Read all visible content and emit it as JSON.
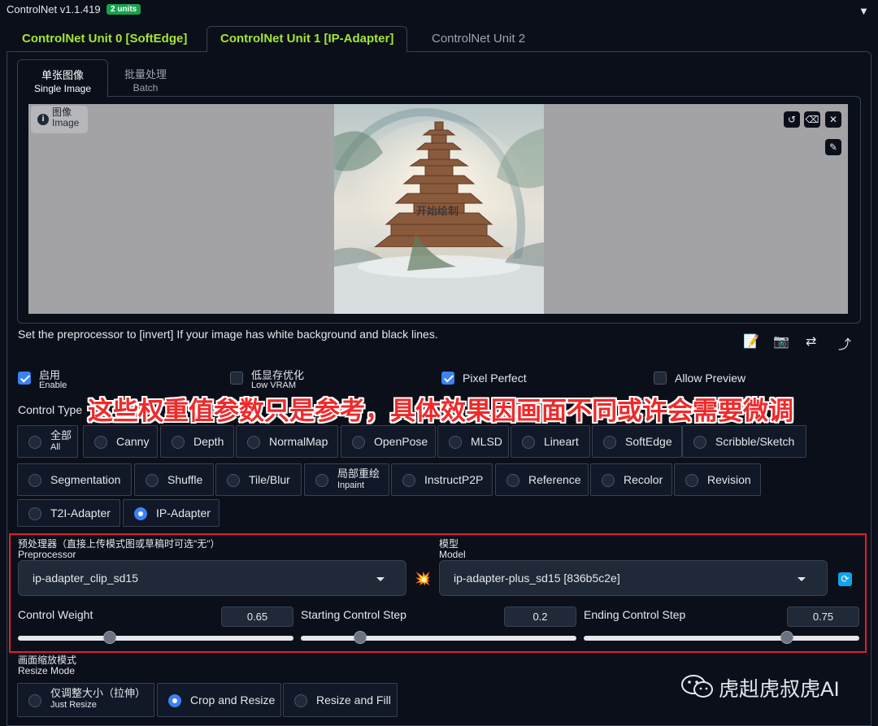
{
  "header": {
    "title": "ControlNet v1.1.419",
    "badge": "2 units",
    "collapse_icon": "triangle-down-icon"
  },
  "unit_tabs": [
    {
      "label": "ControlNet Unit 0 [SoftEdge]"
    },
    {
      "label": "ControlNet Unit 1 [IP-Adapter]"
    },
    {
      "label": "ControlNet Unit 2"
    }
  ],
  "image_tabs": [
    {
      "label": "单张图像",
      "sub": "Single Image"
    },
    {
      "label": "批量处理",
      "sub": "Batch"
    }
  ],
  "image_input": {
    "label": "图像",
    "sub": "Image",
    "draw_text": "开始绘制"
  },
  "hint": "Set the preprocessor to [invert] If your image has white background and black lines.",
  "checks": {
    "enable": {
      "label": "启用",
      "sub": "Enable",
      "checked": true
    },
    "low_vram": {
      "label": "低显存优化",
      "sub": "Low VRAM",
      "checked": false
    },
    "pixel_perfect": {
      "label": "Pixel Perfect",
      "checked": true
    },
    "allow_preview": {
      "label": "Allow Preview",
      "checked": false
    }
  },
  "control_type": {
    "label": "Control Type",
    "selected": "IP-Adapter",
    "all": {
      "label": "全部",
      "sub": "All"
    },
    "inpaint": {
      "label": "局部重绘",
      "sub": "Inpaint"
    },
    "options": [
      "Canny",
      "Depth",
      "NormalMap",
      "OpenPose",
      "MLSD",
      "Lineart",
      "SoftEdge",
      "Scribble/Sketch",
      "Segmentation",
      "Shuffle",
      "Tile/Blur",
      "InstructP2P",
      "Reference",
      "Recolor",
      "Revision",
      "T2I-Adapter",
      "IP-Adapter"
    ]
  },
  "overlay_annotation": "这些权重值参数只是参考，具体效果因画面不同或许会需要微调",
  "preprocessor": {
    "label": "预处理器（直接上传模式图或草稿时可选\"无\"）",
    "sub": "Preprocessor",
    "value": "ip-adapter_clip_sd15"
  },
  "model": {
    "label": "模型",
    "sub": "Model",
    "value": "ip-adapter-plus_sd15 [836b5c2e]"
  },
  "sliders": {
    "control_weight": {
      "label": "Control Weight",
      "value": "0.65",
      "fraction": 0.325
    },
    "starting_step": {
      "label": "Starting Control Step",
      "value": "0.2",
      "fraction": 0.2
    },
    "ending_step": {
      "label": "Ending Control Step",
      "value": "0.75",
      "fraction": 0.75
    }
  },
  "resize_mode": {
    "label": "画面缩放模式",
    "sub": "Resize Mode",
    "just_resize": {
      "label": "仅调整大小（拉伸）",
      "sub": "Just Resize"
    },
    "crop_resize": "Crop and Resize",
    "resize_fill": "Resize and Fill",
    "selected": "Crop and Resize"
  },
  "watermark": "虎赳虎叔虎AI",
  "colors": {
    "accent": "#3b82f6",
    "tab_green": "#a3e635",
    "annotation_red": "#ef2a2a",
    "badge_green": "#16a34a"
  }
}
